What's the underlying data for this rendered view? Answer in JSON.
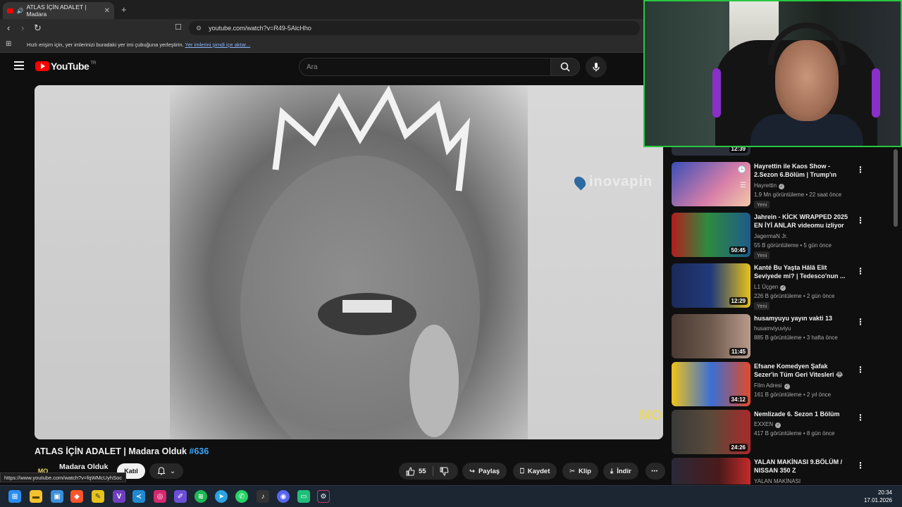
{
  "browser": {
    "tab_title": "ATLAS İÇİN ADALET | Madara",
    "url": "youtube.com/watch?v=R49-5AlcHho",
    "bookmarks_text": "Hızlı erişim için, yer imlerinizi buradaki yer imi çubuğuna yerleştirin.",
    "bookmarks_link": "Yer imlerini şimdi içe aktar...",
    "status_url": "https://www.youtube.com/watch?v=fqWMcUyhSoc"
  },
  "masthead": {
    "logo_text": "YouTube",
    "region": "TR",
    "search_placeholder": "Ara"
  },
  "player": {
    "watermark": "inovapin",
    "corner_logo": "MO"
  },
  "video": {
    "title": "ATLAS İÇİN ADALET | Madara Olduk",
    "hashtag": "#636",
    "channel_avatar": "MO",
    "channel": "Madara Olduk",
    "join": "Katıl",
    "likes": "55",
    "share": "Paylaş",
    "save": "Kaydet",
    "clip": "Klip",
    "download": "İndir"
  },
  "recommendations": [
    {
      "title": "",
      "channel": "",
      "meta": "",
      "duration": "12:39",
      "new": ""
    },
    {
      "title": "Hayrettin ile Kaos Show - 2.Sezon 6.Bölüm | Trump'ın Kı...",
      "channel": "Hayrettin",
      "verified": true,
      "meta": "1,9 Mn görüntüleme • 22 saat önce",
      "duration": "",
      "new": "Yeni"
    },
    {
      "title": "Jahrein - KİCK WRAPPED 2025 EN İYİ ANLAR videomu izliyor",
      "channel": "JagermaN Jr.",
      "verified": false,
      "meta": "55 B görüntüleme • 5 gün önce",
      "duration": "50:45",
      "new": "Yeni"
    },
    {
      "title": "Kanté Bu Yaşta Hâlâ Elit Seviyede mi? | Tedesco'nun ...",
      "channel": "L1 Üçgen",
      "verified": true,
      "meta": "226 B görüntüleme • 2 gün önce",
      "duration": "12:29",
      "new": "Yeni"
    },
    {
      "title": "husamyuyu yayın vakti 13",
      "channel": "husamviyuviyu",
      "verified": false,
      "meta": "885 B görüntüleme • 3 hafta önce",
      "duration": "11:45",
      "new": ""
    },
    {
      "title": "Efsane Komedyen Şafak Sezer'in Tüm Geri Vitesleri 😂",
      "channel": "Film Adresi",
      "verified": true,
      "meta": "161 B görüntüleme • 2 yıl önce",
      "duration": "34:12",
      "new": ""
    },
    {
      "title": "Nemlizade 6. Sezon 1 Bölüm",
      "channel": "EXXEN",
      "verified": true,
      "meta": "417 B görüntüleme • 8 gün önce",
      "duration": "24:26",
      "new": ""
    },
    {
      "title": "YALAN MAKİNASI 9.BÖLÜM / NISSAN 350 Z",
      "channel": "YALAN MAKİNASI",
      "verified": false,
      "meta": "",
      "duration": "",
      "new": ""
    }
  ],
  "taskbar": {
    "time": "20:34",
    "date": "17.01.2026"
  },
  "colors": {
    "accent_link": "#3ea6ff",
    "yt_red": "#ff0000",
    "webcam_border": "#28c840"
  }
}
